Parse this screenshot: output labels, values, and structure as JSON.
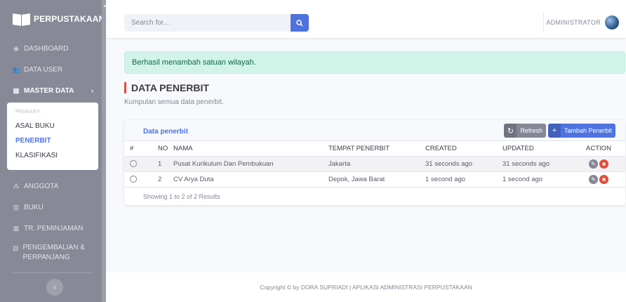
{
  "app": {
    "brand": "PERPUSTAKAAN"
  },
  "sidebar": {
    "items": [
      {
        "label": "DASHBOARD",
        "icon": "tachometer-icon"
      },
      {
        "label": "DATA USER",
        "icon": "users-icon"
      },
      {
        "label": "MASTER DATA",
        "icon": "database-icon"
      },
      {
        "label": "ANGGOTA",
        "icon": "user-friends-icon"
      },
      {
        "label": "BUKU",
        "icon": "book-icon"
      },
      {
        "label": "TR. PEMINJAMAN",
        "icon": "exchange-icon"
      },
      {
        "label": "PENGEMBALIAN & PERPANJANG",
        "icon": "return-icon"
      }
    ],
    "submenu": {
      "header": "PRIMARY:",
      "items": [
        "ASAL BUKU",
        "PENERBIT",
        "KLASIFIKASI"
      ],
      "active": "PENERBIT"
    }
  },
  "topbar": {
    "search_placeholder": "Search for...",
    "user_name": "ADMINISTRATOR"
  },
  "alert": {
    "message": "Berhasil menambah satuan wilayah."
  },
  "page": {
    "title": "DATA PENERBIT",
    "subtitle": "Kumpulan semua data penerbit."
  },
  "card": {
    "title": "Data penerbit",
    "refresh_label": "Refresh",
    "add_label": "Tambah Penerbit"
  },
  "table": {
    "headers": {
      "check": "#",
      "no": "NO",
      "nama": "NAMA",
      "tempat": "TEMPAT PENERBIT",
      "created": "CREATED",
      "updated": "UPDATED",
      "action": "ACTION"
    },
    "rows": [
      {
        "no": "1",
        "nama": "Pusat Kurikulum Dan Pembukuan",
        "tempat": "Jakarta",
        "created": "31 seconds ago",
        "updated": "31 seconds ago"
      },
      {
        "no": "2",
        "nama": "CV Arya Duta",
        "tempat": "Depok, Jawa Barat",
        "created": "1 second ago",
        "updated": "1 second ago"
      }
    ],
    "summary": "Showing 1 to 2 of 2 Results"
  },
  "footer": {
    "text": "Copyright © by DORA SUPRIADI | APLIKASI ADMINISTRASI PERPUSTAKAAN"
  },
  "colors": {
    "primary": "#4e73df",
    "sidebar": "#878a96",
    "danger": "#e74a3b",
    "success_bg": "#d2f4e8"
  }
}
